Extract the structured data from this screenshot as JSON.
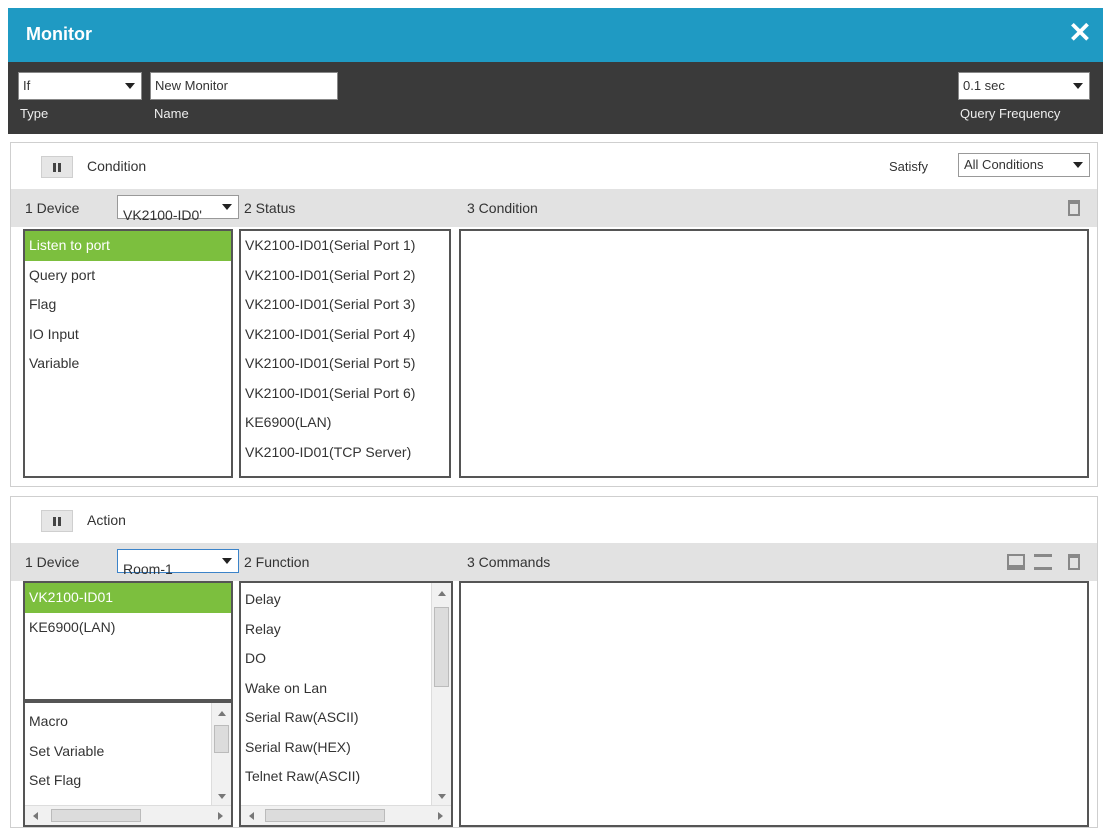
{
  "window": {
    "title": "Monitor",
    "close_glyph": "✕"
  },
  "topbar": {
    "type": {
      "value": "If",
      "label": "Type"
    },
    "name": {
      "value": "New Monitor",
      "label": "Name"
    },
    "frequency": {
      "value": "0.1 sec",
      "label": "Query Frequency"
    }
  },
  "condition": {
    "title": "Condition",
    "satisfy_label": "Satisfy",
    "satisfy_value": "All Conditions",
    "col1": "1  Device",
    "device_value": "VK2100-ID0'",
    "col2": "2  Status",
    "col3": "3  Condition",
    "device_items": [
      "Listen to port",
      "Query port",
      "Flag",
      "IO Input",
      "Variable"
    ],
    "status_items": [
      "VK2100-ID01(Serial Port 1)",
      "VK2100-ID01(Serial Port 2)",
      "VK2100-ID01(Serial Port 3)",
      "VK2100-ID01(Serial Port 4)",
      "VK2100-ID01(Serial Port 5)",
      "VK2100-ID01(Serial Port 6)",
      "KE6900(LAN)",
      "VK2100-ID01(TCP Server)"
    ]
  },
  "action": {
    "title": "Action",
    "col1": "1  Device",
    "device_value": "Room-1",
    "col2": "2  Function",
    "col3": "3  Commands",
    "device_items": [
      "VK2100-ID01",
      "KE6900(LAN)"
    ],
    "misc_items": [
      "Macro",
      "Set Variable",
      "Set Flag"
    ],
    "function_items": [
      "Delay",
      "Relay",
      "DO",
      "Wake on Lan",
      "Serial Raw(ASCII)",
      "Serial Raw(HEX)",
      "Telnet Raw(ASCII)"
    ]
  },
  "colors": {
    "title_bar": "#1f9ac3",
    "top_bar": "#3a3a3a",
    "selected": "#7cbf3e"
  }
}
